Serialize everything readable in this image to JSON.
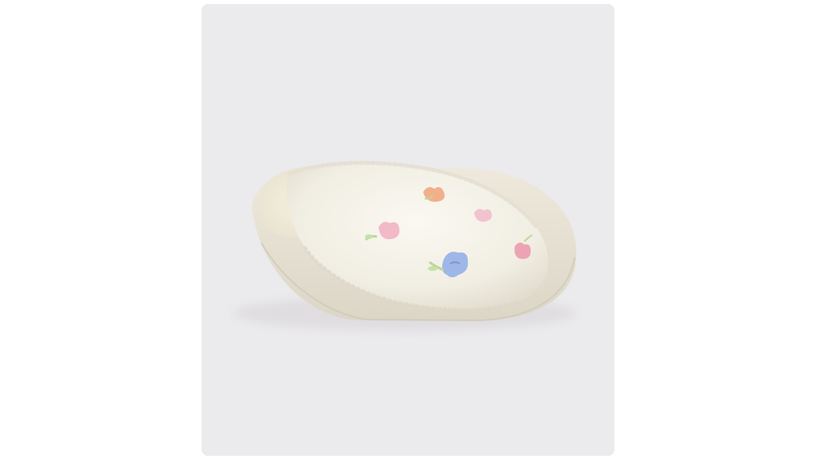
{
  "product_image": {
    "alt": "",
    "colors": {
      "background": "#ebeaec",
      "slipper_body": "#f3f0e6",
      "slipper_shadow": "#d9d4c6",
      "sole": "#e9e4d6",
      "flower_pink": "#f2b9c8",
      "flower_peach": "#f2b08a",
      "flower_blue": "#9fb6e8",
      "flower_rose": "#eea3b4",
      "leaf_green": "#b9d89a"
    }
  }
}
